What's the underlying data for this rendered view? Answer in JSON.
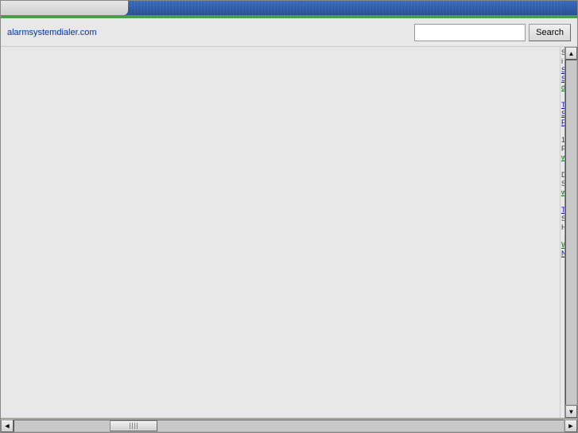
{
  "header": {
    "site_url": "alarmsystemdialer.com",
    "bar_left_color": "#d0d0d0",
    "bar_center_color": "#3a6abf",
    "green_line_color": "#4a9e4a"
  },
  "toolbar": {
    "search_button_label": "Search",
    "search_placeholder": ""
  },
  "sidebar": {
    "sections": [
      {
        "id": "s1",
        "lines": [
          "S",
          "i"
        ]
      },
      {
        "id": "s2",
        "links": [
          "S",
          "S",
          "d"
        ]
      },
      {
        "id": "s3",
        "lines": [
          "T"
        ],
        "links": [
          "S",
          "F"
        ]
      },
      {
        "id": "s4",
        "lines": [
          "1",
          "F"
        ],
        "links": [
          "w"
        ]
      },
      {
        "id": "s5",
        "lines": [
          "D",
          "S"
        ],
        "links": [
          "w"
        ]
      },
      {
        "id": "s6",
        "lines": [
          "T",
          "S",
          "H"
        ]
      },
      {
        "id": "s7",
        "links": [
          "W",
          "N"
        ]
      }
    ]
  },
  "scrollbar": {
    "left_arrow": "◄",
    "right_arrow": "►",
    "up_arrow": "▲",
    "down_arrow": "▼"
  }
}
